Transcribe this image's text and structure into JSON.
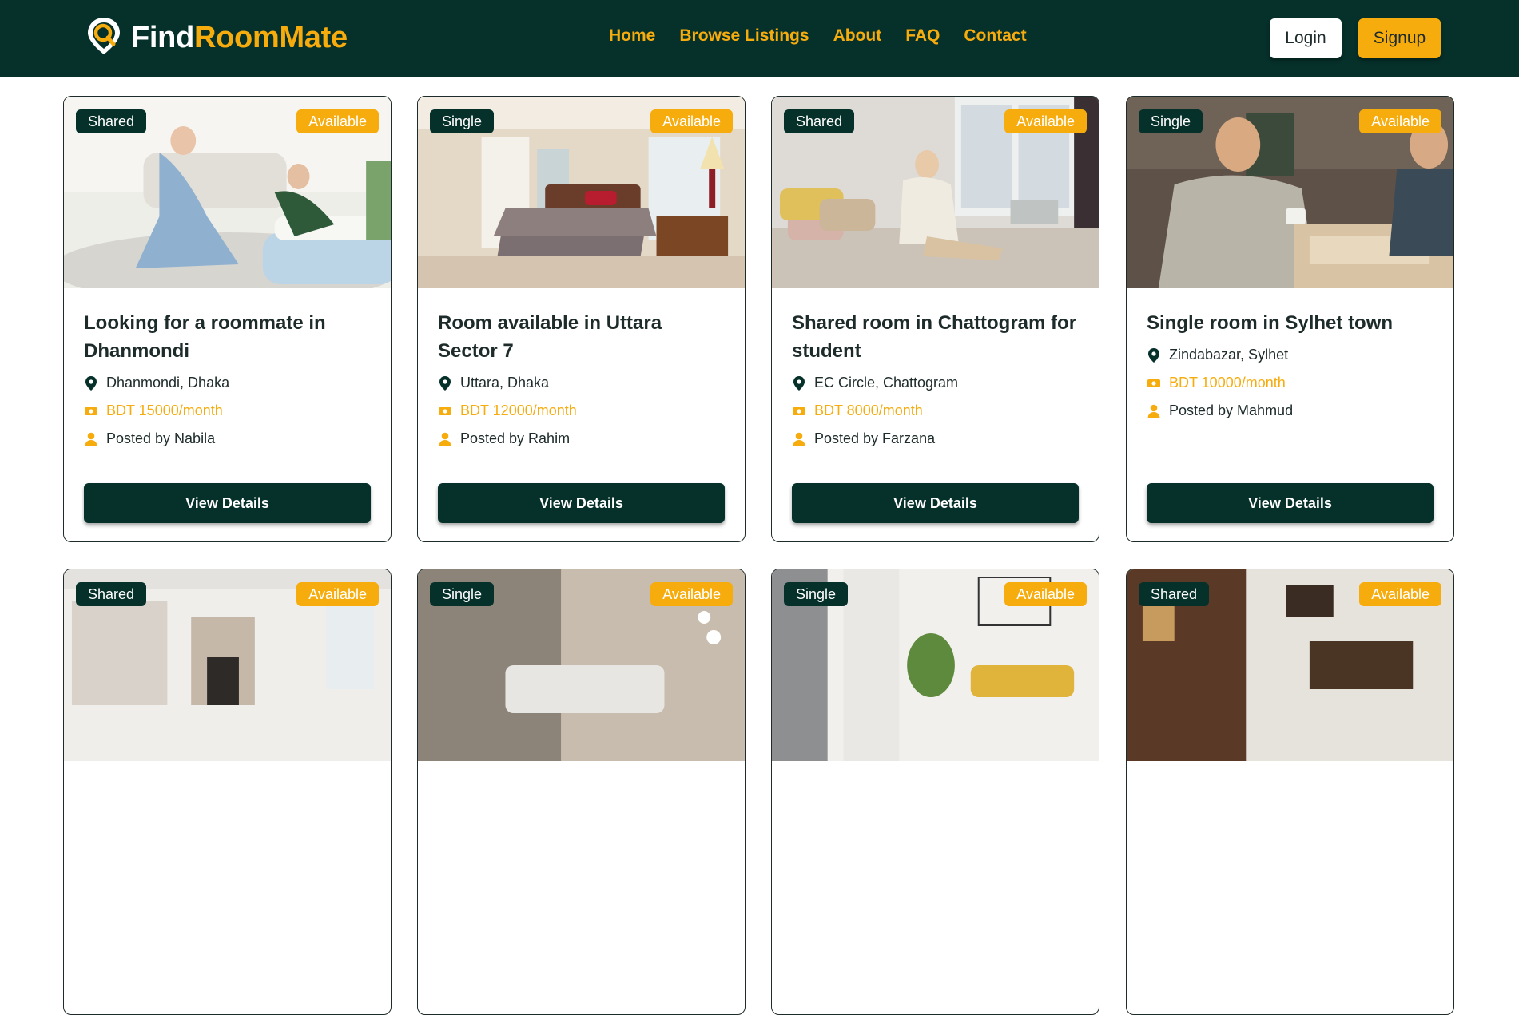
{
  "header": {
    "brand_part1": "Find",
    "brand_part2": "RoomMate",
    "nav": [
      "Home",
      "Browse Listings",
      "About",
      "FAQ",
      "Contact"
    ],
    "login_label": "Login",
    "signup_label": "Signup"
  },
  "colors": {
    "primary_dark": "#06302a",
    "accent": "#f7ac0e",
    "text": "#1d2b2a"
  },
  "listings": [
    {
      "type": "Shared",
      "status": "Available",
      "title": "Looking for a roommate in Dhanmondi",
      "location": "Dhanmondi, Dhaka",
      "rent": "BDT 15000/month",
      "posted_by": "Posted by Nabila",
      "button": "View Details"
    },
    {
      "type": "Single",
      "status": "Available",
      "title": "Room available in Uttara Sector 7",
      "location": "Uttara, Dhaka",
      "rent": "BDT 12000/month",
      "posted_by": "Posted by Rahim",
      "button": "View Details"
    },
    {
      "type": "Shared",
      "status": "Available",
      "title": "Shared room in Chattogram for student",
      "location": "EC Circle, Chattogram",
      "rent": "BDT 8000/month",
      "posted_by": "Posted by Farzana",
      "button": "View Details"
    },
    {
      "type": "Single",
      "status": "Available",
      "title": "Single room in Sylhet town",
      "location": "Zindabazar, Sylhet",
      "rent": "BDT 10000/month",
      "posted_by": "Posted by Mahmud",
      "button": "View Details"
    },
    {
      "type": "Shared",
      "status": "Available"
    },
    {
      "type": "Single",
      "status": "Available"
    },
    {
      "type": "Single",
      "status": "Available"
    },
    {
      "type": "Shared",
      "status": "Available"
    }
  ],
  "icons": {
    "location": "map-pin-icon",
    "rent": "money-icon",
    "poster": "user-icon",
    "brand": "location-search-logo-icon"
  }
}
